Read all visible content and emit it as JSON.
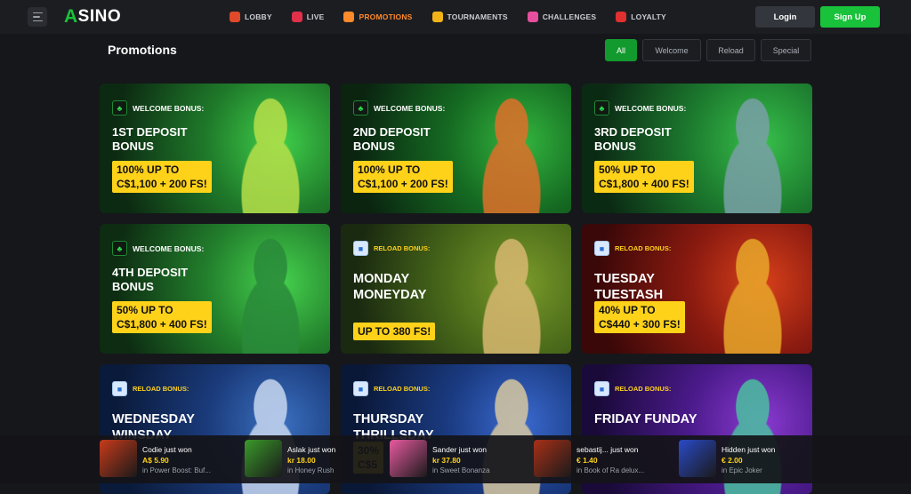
{
  "header": {
    "logo_a": "A",
    "logo_rest": "SINO",
    "nav": [
      {
        "label": "LOBBY",
        "icon": "lobby-icon",
        "color": "#e04a2a",
        "active": false
      },
      {
        "label": "LIVE",
        "icon": "live-icon",
        "color": "#e0304a",
        "active": false
      },
      {
        "label": "PROMOTIONS",
        "icon": "promotions-icon",
        "color": "#ff8a2a",
        "active": true
      },
      {
        "label": "TOURNAMENTS",
        "icon": "tournaments-icon",
        "color": "#f0b418",
        "active": false
      },
      {
        "label": "CHALLENGES",
        "icon": "challenges-icon",
        "color": "#e64fa0",
        "active": false
      },
      {
        "label": "LOYALTY",
        "icon": "loyalty-icon",
        "color": "#e03030",
        "active": false
      }
    ],
    "login": "Login",
    "signup": "Sign Up"
  },
  "page": {
    "title": "Promotions",
    "filters": [
      {
        "label": "All",
        "active": true
      },
      {
        "label": "Welcome",
        "active": false
      },
      {
        "label": "Reload",
        "active": false
      },
      {
        "label": "Special",
        "active": false
      }
    ]
  },
  "cards": [
    {
      "tag": "WELCOME BONUS:",
      "kind": "welcome",
      "title": "1ST DEPOSIT BONUS",
      "offer_1": "100% UP TO",
      "offer_2": "C$1,100 + 200 FS!",
      "colors": [
        "#0c2a12",
        "#1f7a2a",
        "#3fcf4a"
      ],
      "art": "#b8e04a"
    },
    {
      "tag": "WELCOME BONUS:",
      "kind": "welcome",
      "title": "2ND DEPOSIT BONUS",
      "offer_1": "100% UP TO",
      "offer_2": "C$1,100 + 200 FS!",
      "colors": [
        "#0a2410",
        "#156a22",
        "#33b63e"
      ],
      "art": "#e0702a"
    },
    {
      "tag": "WELCOME BONUS:",
      "kind": "welcome",
      "title": "3RD DEPOSIT BONUS",
      "offer_1": "50% UP TO",
      "offer_2": "C$1,800 + 400 FS!",
      "colors": [
        "#0b2a14",
        "#1c7a2e",
        "#37c04a"
      ],
      "art": "#7aa0a8"
    },
    {
      "tag": "WELCOME BONUS:",
      "kind": "welcome",
      "title": "4TH DEPOSIT BONUS",
      "offer_1": "50% UP TO",
      "offer_2": "C$1,800 + 400 FS!",
      "colors": [
        "#0d2c12",
        "#227f2c",
        "#46d24e"
      ],
      "art": "#2a8a3a"
    },
    {
      "tag": "RELOAD BONUS:",
      "kind": "reload",
      "title": "MONDAY MONEYDAY",
      "offer_1": "UP TO 380 FS!",
      "offer_2": "",
      "colors": [
        "#1a2a10",
        "#4a6a1a",
        "#7a9a2a"
      ],
      "art": "#d8b870"
    },
    {
      "tag": "RELOAD BONUS:",
      "kind": "reload",
      "title": "TUESDAY TUESTASH",
      "offer_1": "40% UP TO",
      "offer_2": "C$440 + 300 FS!",
      "colors": [
        "#3a0808",
        "#8a1a10",
        "#d8401a"
      ],
      "art": "#e8a82a"
    },
    {
      "tag": "RELOAD BONUS:",
      "kind": "reload",
      "title": "WEDNESDAY WINSDAY",
      "offer_1": "",
      "offer_2": "",
      "colors": [
        "#0a1a3a",
        "#1a3a7a",
        "#3a70c0"
      ],
      "art": "#c8d8f0"
    },
    {
      "tag": "RELOAD BONUS:",
      "kind": "reload",
      "title": "THURSDAY THRILLSDAY",
      "offer_1": "30%",
      "offer_2": "C$5",
      "colors": [
        "#0a1838",
        "#1a3a80",
        "#3a6ad0"
      ],
      "art": "#d8c8a0"
    },
    {
      "tag": "RELOAD BONUS:",
      "kind": "reload",
      "title": "FRIDAY FUNDAY",
      "offer_1": "",
      "offer_2": "",
      "colors": [
        "#1a0a3a",
        "#4a1a8a",
        "#8a3ad0"
      ],
      "art": "#4ac0a0"
    }
  ],
  "wins": [
    {
      "who": "Codie just won",
      "amount": "A$ 5.90",
      "game": "in Power Boost: Buf...",
      "thumb": "#c83a1a"
    },
    {
      "who": "Aslak just won",
      "amount": "kr 18.00",
      "game": "in Honey Rush",
      "thumb": "#3a9a2a"
    },
    {
      "who": "Sander just won",
      "amount": "kr 37.80",
      "game": "in Sweet Bonanza",
      "thumb": "#e85aa0"
    },
    {
      "who": "sebastij... just won",
      "amount": "€ 1.40",
      "game": "in Book of Ra delux...",
      "thumb": "#a83018"
    },
    {
      "who": "Hidden just won",
      "amount": "€ 2.00",
      "game": "in Epic Joker",
      "thumb": "#2a4ac8"
    }
  ]
}
